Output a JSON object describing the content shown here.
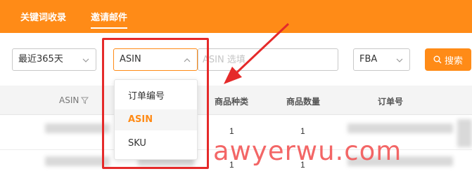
{
  "nav": {
    "tabs": [
      {
        "label": "关键词收录"
      },
      {
        "label": "邀请邮件"
      }
    ]
  },
  "filters": {
    "date_range": "最近365天",
    "search_type": "ASIN",
    "asin_input_placeholder": "ASIN 选填",
    "fulfillment": "FBA",
    "search_button": "搜索"
  },
  "dropdown": {
    "options": [
      {
        "label": "订单编号"
      },
      {
        "label": "ASIN"
      },
      {
        "label": "SKU"
      }
    ],
    "selected": "ASIN"
  },
  "table": {
    "headers": {
      "asin": "ASIN",
      "product_kinds": "商品种类",
      "product_qty": "商品数量",
      "order_no": "订单号"
    },
    "rows": [
      {
        "kinds": "1",
        "qty": "1"
      },
      {
        "kinds": "1",
        "qty": "1"
      }
    ]
  },
  "watermark": "awyerwu.com",
  "colors": {
    "accent": "#ff8b17",
    "annotation_red": "#e52a2a"
  }
}
